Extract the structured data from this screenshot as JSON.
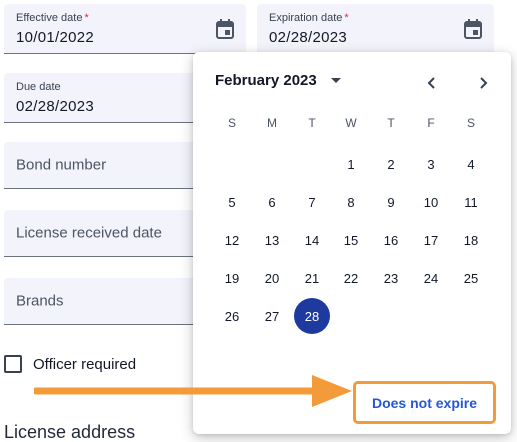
{
  "form": {
    "effective_date": {
      "label": "Effective date",
      "required": "*",
      "value": "10/01/2022"
    },
    "expiration_date": {
      "label": "Expiration date",
      "required": "*",
      "value": "02/28/2023"
    },
    "due_date": {
      "label": "Due date",
      "value": "02/28/2023"
    },
    "bond_number": {
      "placeholder": "Bond number"
    },
    "license_received_date": {
      "placeholder": "License received date"
    },
    "brands": {
      "placeholder": "Brands"
    },
    "officer_required": {
      "label": "Officer required",
      "checked": false
    },
    "license_address_heading": "License address"
  },
  "calendar": {
    "month_label": "February 2023",
    "weekdays": [
      "S",
      "M",
      "T",
      "W",
      "T",
      "F",
      "S"
    ],
    "first_weekday_index": 3,
    "days_in_month": 28,
    "selected_day": 28,
    "does_not_expire_label": "Does not expire"
  },
  "icons": {
    "date_picker": "calendar-icon",
    "month_dropdown": "caret-down-icon",
    "prev": "chevron-left-icon",
    "next": "chevron-right-icon"
  },
  "colors": {
    "field_background": "#f3f4fb",
    "required_star": "#d32f2f",
    "selected_day": "#1e3a9e",
    "link": "#2457d6",
    "highlight": "#f39a3a"
  }
}
